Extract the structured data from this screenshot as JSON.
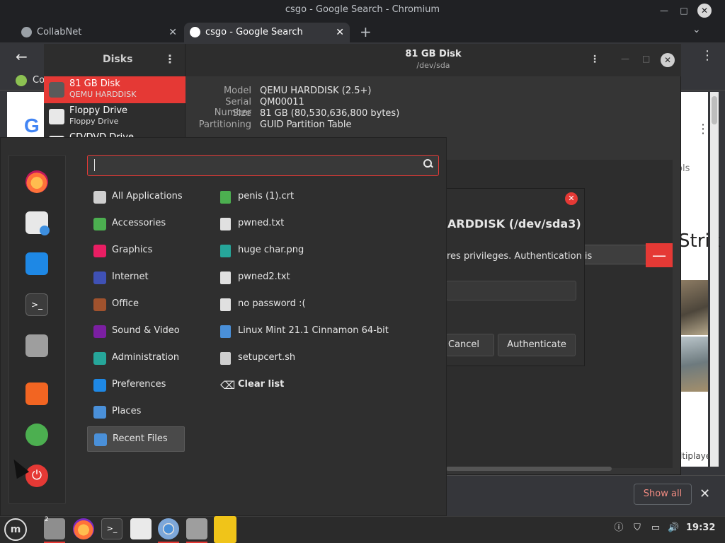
{
  "chromium": {
    "window_title": "csgo - Google Search - Chromium",
    "tabs": [
      {
        "label": "CollabNet",
        "close": "✕"
      },
      {
        "label": "csgo - Google Search",
        "close": "✕"
      }
    ],
    "new_tab": "+",
    "tabs_menu": "⌄",
    "back": "←",
    "menu": "⋮",
    "bookmark_label": "Co",
    "page": {
      "logo_fragment": "G",
      "tools": "ols",
      "headline_fragment": "Strik",
      "footer_fragment": "ltiplaye"
    },
    "downloads": {
      "show_all": "Show all",
      "close": "✕"
    }
  },
  "disks": {
    "title": "Disks",
    "header_title": "81 GB Disk",
    "header_subtitle": "/dev/sda",
    "devices": [
      {
        "name": "81 GB Disk",
        "sub": "QEMU HARDDISK"
      },
      {
        "name": "Floppy Drive",
        "sub": "Floppy Drive"
      },
      {
        "name": "CD/DVD Drive",
        "sub": ""
      }
    ],
    "properties": [
      {
        "label": "Model",
        "value": "QEMU HARDDISK (2.5+)"
      },
      {
        "label": "Serial Number",
        "value": "QM00011"
      },
      {
        "label": "Size",
        "value": "81 GB (80,530,636,800 bytes)"
      },
      {
        "label": "Partitioning",
        "value": "GUID Partition Table"
      }
    ],
    "minus": "—"
  },
  "auth_dialog": {
    "heading": "ARDDISK (/dev/sda3)",
    "message": "res privileges. Authentication is",
    "cancel": "Cancel",
    "authenticate": "Authenticate",
    "close": "✕"
  },
  "menu": {
    "search": {
      "value": "",
      "placeholder": ""
    },
    "categories": [
      {
        "label": "All Applications",
        "icon": "grid-icon",
        "color": "#cfcfcf"
      },
      {
        "label": "Accessories",
        "icon": "accessories-icon",
        "color": "#4caf50"
      },
      {
        "label": "Graphics",
        "icon": "graphics-icon",
        "color": "#e91e63"
      },
      {
        "label": "Internet",
        "icon": "internet-icon",
        "color": "#3f51b5"
      },
      {
        "label": "Office",
        "icon": "office-icon",
        "color": "#a0522d"
      },
      {
        "label": "Sound & Video",
        "icon": "sound-video-icon",
        "color": "#7b1fa2"
      },
      {
        "label": "Administration",
        "icon": "administration-icon",
        "color": "#26a69a"
      },
      {
        "label": "Preferences",
        "icon": "preferences-icon",
        "color": "#1e88e5"
      },
      {
        "label": "Places",
        "icon": "folder-icon",
        "color": "#4a90d9"
      },
      {
        "label": "Recent Files",
        "icon": "recent-files-icon",
        "color": "#4a90d9"
      }
    ],
    "recent_files": [
      {
        "label": "penis (1).crt",
        "icon": "certificate-icon",
        "color": "#4caf50"
      },
      {
        "label": "pwned.txt",
        "icon": "text-file-icon",
        "color": "#e0e0e0"
      },
      {
        "label": "huge char.png",
        "icon": "image-file-icon",
        "color": "#26a69a"
      },
      {
        "label": "pwned2.txt",
        "icon": "text-file-icon",
        "color": "#e0e0e0"
      },
      {
        "label": "no password :(",
        "icon": "text-file-icon",
        "color": "#e0e0e0"
      },
      {
        "label": "Linux Mint 21.1 Cinnamon 64-bit",
        "icon": "folder-icon",
        "color": "#4a90d9"
      },
      {
        "label": "setupcert.sh",
        "icon": "script-file-icon",
        "color": "#cfcfcf"
      }
    ],
    "clear_list": "Clear list",
    "favorites": [
      "firefox-icon",
      "software-manager-icon",
      "settings-icon",
      "terminal-icon",
      "files-icon",
      "lock-icon",
      "logout-icon",
      "power-icon"
    ],
    "terminal_glyph": ">_",
    "power_glyph": "⏻"
  },
  "taskbar": {
    "menu_glyph": "m",
    "files_count": "2",
    "terminal_glyph": ">_",
    "clock": "19:32",
    "tray": [
      "ⓘ",
      "⛉",
      "▭",
      "🔊"
    ]
  }
}
